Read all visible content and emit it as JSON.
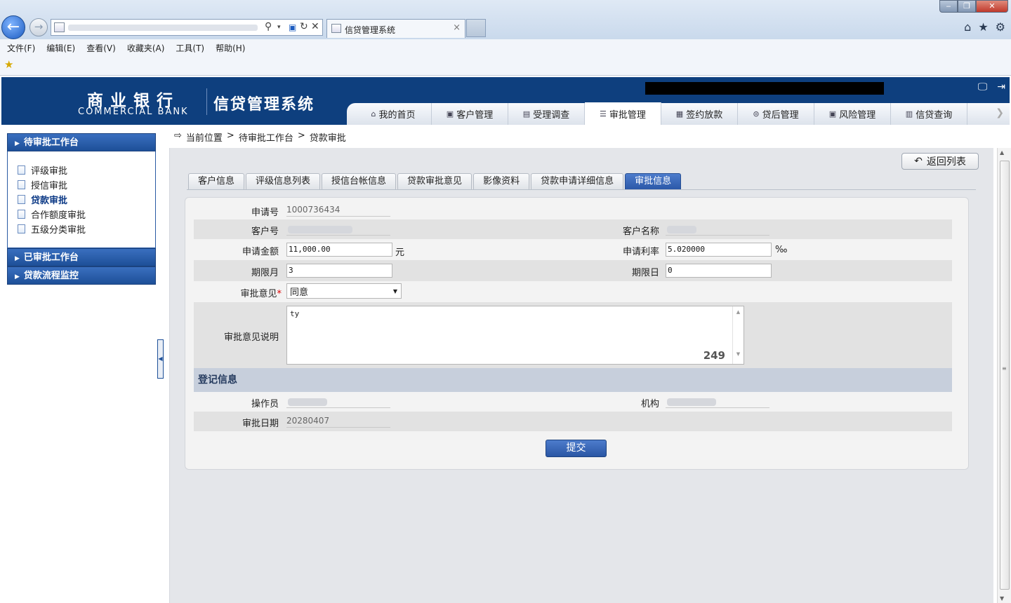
{
  "browser": {
    "tab_title": "信贷管理系统",
    "tab_close": "×",
    "menu": [
      "文件(F)",
      "编辑(E)",
      "查看(V)",
      "收藏夹(A)",
      "工具(T)",
      "帮助(H)"
    ]
  },
  "header": {
    "bank_name_cn": "商业银行",
    "bank_name_en": "COMMERCIAL BANK",
    "system_name": "信贷管理系统"
  },
  "nav": {
    "items": [
      {
        "label": "我的首页",
        "icon": "home-icon"
      },
      {
        "label": "客户管理",
        "icon": "customer-icon"
      },
      {
        "label": "受理调查",
        "icon": "survey-icon"
      },
      {
        "label": "审批管理",
        "icon": "approval-icon"
      },
      {
        "label": "签约放款",
        "icon": "contract-icon"
      },
      {
        "label": "贷后管理",
        "icon": "post-loan-icon"
      },
      {
        "label": "风险管理",
        "icon": "risk-icon"
      },
      {
        "label": "信贷查询",
        "icon": "query-icon"
      }
    ],
    "active_index": 3
  },
  "sidebar": {
    "groups": [
      {
        "title": "待审批工作台",
        "items": [
          "评级审批",
          "授信审批",
          "贷款审批",
          "合作额度审批",
          "五级分类审批"
        ],
        "active_item": 2
      },
      {
        "title": "已审批工作台"
      },
      {
        "title": "贷款流程监控"
      }
    ]
  },
  "breadcrumb": {
    "label": "当前位置",
    "sep": ">",
    "path": [
      "待审批工作台",
      "贷款审批"
    ]
  },
  "actions": {
    "back_to_list": "返回列表",
    "submit": "提交"
  },
  "tabs": [
    "客户信息",
    "评级信息列表",
    "授信台帐信息",
    "贷款审批意见",
    "影像资料",
    "贷款申请详细信息",
    "审批信息"
  ],
  "active_tab": 6,
  "form": {
    "application_no": {
      "label": "申请号",
      "value": "1000736434"
    },
    "customer_no": {
      "label": "客户号"
    },
    "customer_name": {
      "label": "客户名称"
    },
    "amount": {
      "label": "申请金额",
      "value": "11,000.00",
      "unit": "元"
    },
    "rate": {
      "label": "申请利率",
      "value": "5.020000",
      "unit": "‰"
    },
    "term_month": {
      "label": "期限月",
      "value": "3"
    },
    "term_day": {
      "label": "期限日",
      "value": "0"
    },
    "opinion": {
      "label": "审批意见",
      "required_mark": "*",
      "value": "同意"
    },
    "opinion_desc": {
      "label": "审批意见说明",
      "value": "ty",
      "remaining": "249"
    }
  },
  "registration": {
    "title": "登记信息",
    "operator": {
      "label": "操作员"
    },
    "org": {
      "label": "机构"
    },
    "date": {
      "label": "审批日期",
      "value": "20280407"
    }
  }
}
